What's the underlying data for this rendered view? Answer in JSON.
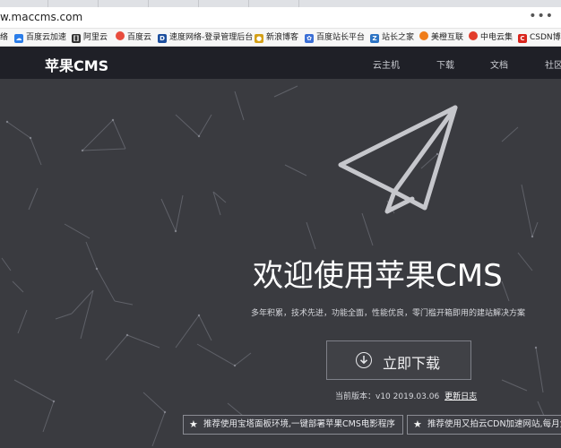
{
  "browser": {
    "url": "w.maccms.com",
    "menu_label": "•••",
    "bookmarks": [
      {
        "label": "络",
        "icon": "",
        "color": "#9aa0a6"
      },
      {
        "label": "百度云加速",
        "icon": "cloud-icon",
        "color": "#2b7de9"
      },
      {
        "label": "阿里云",
        "icon": "aliyun-icon",
        "color": "#333333"
      },
      {
        "label": "百度云",
        "icon": "baidu-cloud-icon",
        "color": "#e84c3d"
      },
      {
        "label": "速度网络-登录管理后台",
        "icon": "sudu-icon",
        "color": "#1d4f9e"
      },
      {
        "label": "新浪博客",
        "icon": "sina-icon",
        "color": "#d4a017"
      },
      {
        "label": "百度站长平台",
        "icon": "paw-icon",
        "color": "#3b6fd6"
      },
      {
        "label": "站长之家",
        "icon": "chinaz-icon",
        "color": "#2d74c4"
      },
      {
        "label": "美橙互联",
        "icon": "orange-icon",
        "color": "#ef7d1a"
      },
      {
        "label": "中电云集",
        "icon": "zdy-icon",
        "color": "#e23c2a"
      },
      {
        "label": "CSDN博",
        "icon": "csdn-icon",
        "color": "#d9251d"
      }
    ]
  },
  "site": {
    "logo": "苹果CMS",
    "nav": [
      "云主机",
      "下载",
      "文档",
      "社区"
    ]
  },
  "hero": {
    "title": "欢迎使用苹果CMS",
    "subtitle": "多年积累，技术先进，功能全面，性能优良，零门槛开箱即用的建站解决方案",
    "download_label": "立即下载",
    "version_text": "当前版本：v10 2019.03.06",
    "changelog_label": "更新日志",
    "promos": [
      "推荐使用宝塔面板环境,一键部署苹果CMS电影程序",
      "推荐使用又拍云CDN加速网站,每月免费"
    ]
  }
}
